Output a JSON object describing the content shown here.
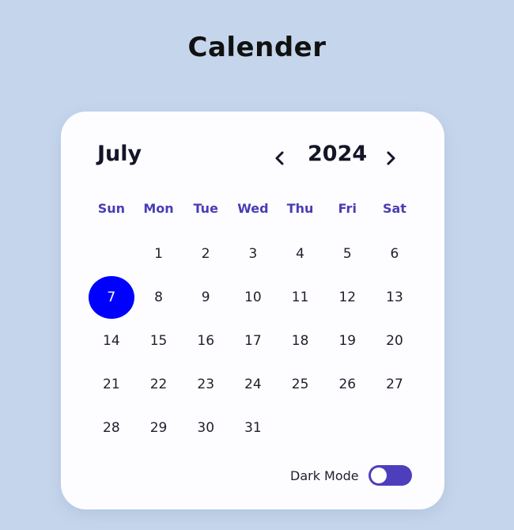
{
  "page": {
    "title": "Calender"
  },
  "calendar": {
    "month": "July",
    "year": "2024",
    "prev_icon": "chevron-left-icon",
    "next_icon": "chevron-right-icon",
    "weekdays": [
      "Sun",
      "Mon",
      "Tue",
      "Wed",
      "Thu",
      "Fri",
      "Sat"
    ],
    "first_weekday_offset": 1,
    "days_in_month": 31,
    "selected_day": 7
  },
  "dark_mode": {
    "label": "Dark Mode",
    "enabled": false
  },
  "colors": {
    "background": "#c5d6ec",
    "card": "#fdfdff",
    "weekday_text": "#4a3db4",
    "selected_day": "#0000ff",
    "toggle_track": "#4d3ebd"
  }
}
